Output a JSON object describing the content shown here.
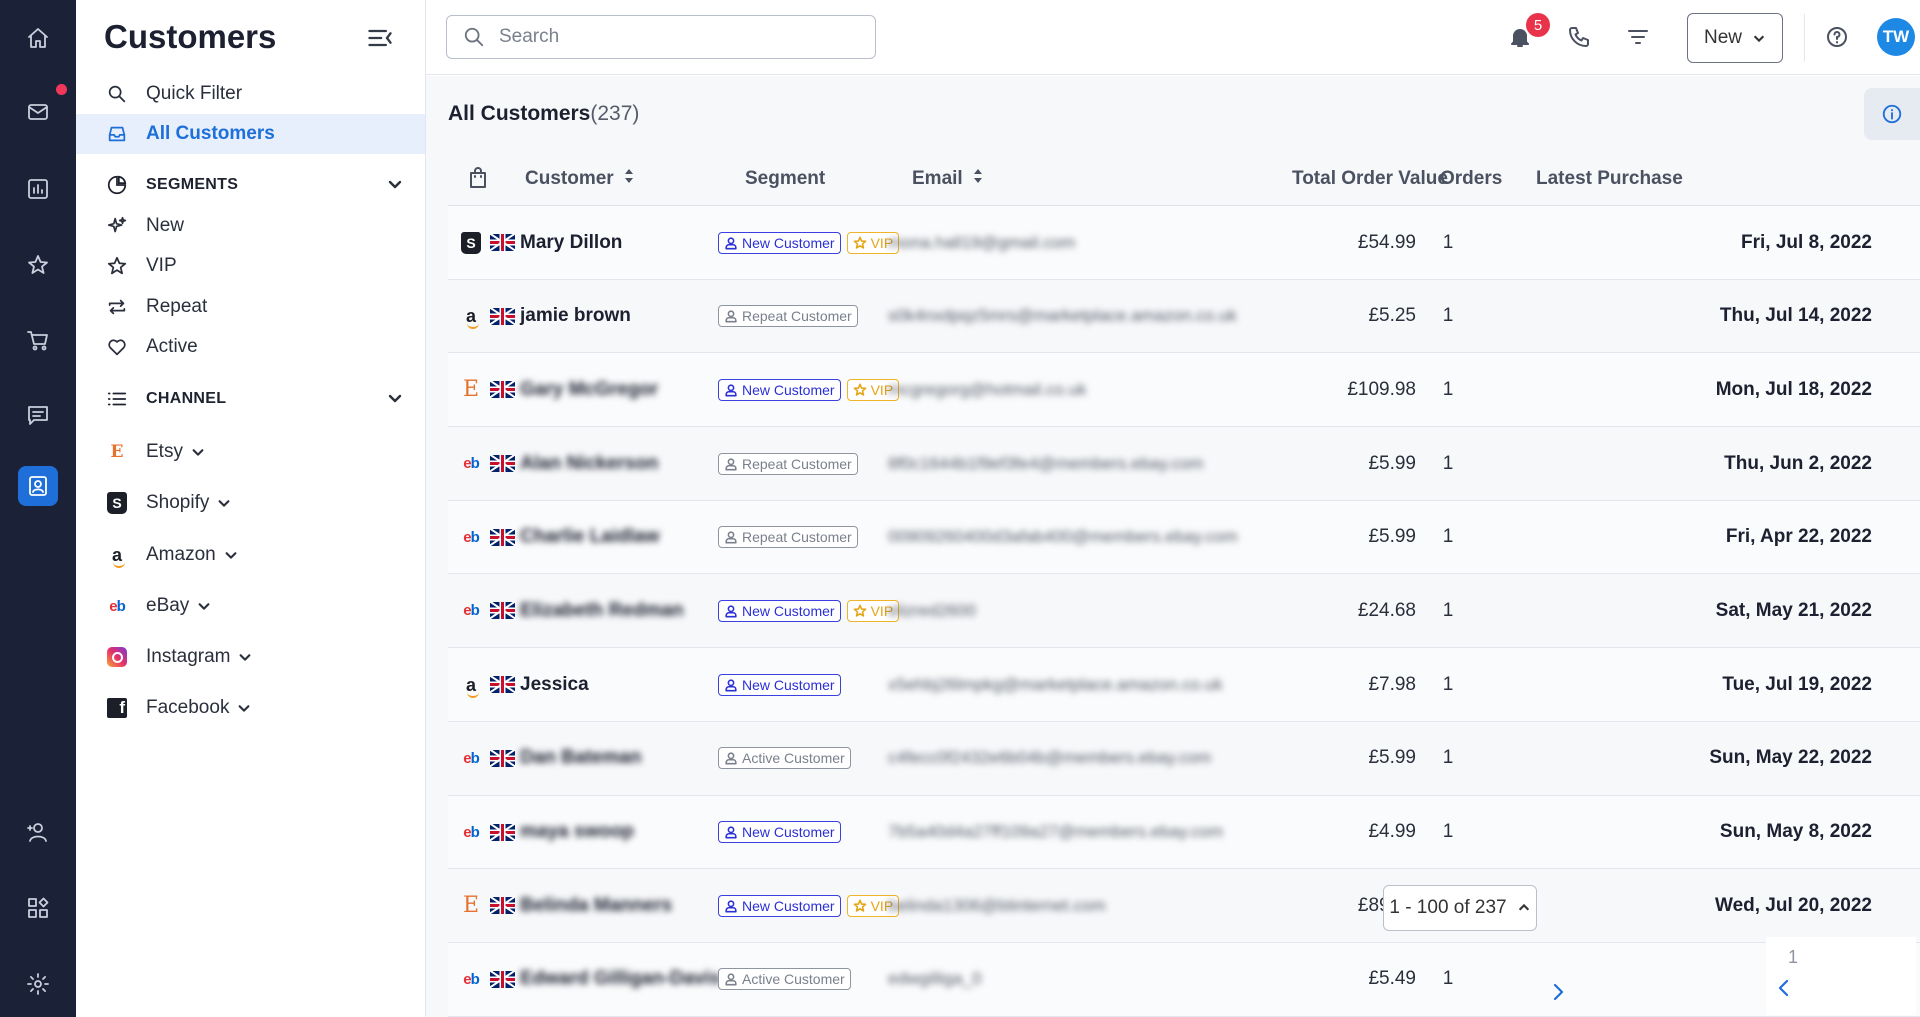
{
  "rail": {
    "items": [
      "home-icon",
      "mail-icon",
      "reports-icon",
      "star-icon",
      "cart-icon",
      "messages-icon",
      "contacts-icon"
    ],
    "bottom": [
      "add-user-icon",
      "apps-icon",
      "settings-icon"
    ],
    "notification_dot_color": "#f2385a",
    "active_color": "#1e6fd9"
  },
  "sidebar": {
    "title": "Customers",
    "quick_filter": "Quick Filter",
    "all_customers": "All Customers",
    "segments_heading": "SEGMENTS",
    "segments": [
      "New",
      "VIP",
      "Repeat",
      "Active"
    ],
    "channel_heading": "CHANNEL",
    "channels": [
      "Etsy",
      "Shopify",
      "Amazon",
      "eBay",
      "Instagram",
      "Facebook"
    ]
  },
  "topbar": {
    "search_placeholder": "Search",
    "notifications_count": "5",
    "new_button": "New",
    "avatar_initials": "TW"
  },
  "main": {
    "title": "All Customers",
    "count": "(237)",
    "columns": {
      "customer": "Customer",
      "segment": "Segment",
      "email": "Email",
      "total": "Total Order Value",
      "orders": "Orders",
      "latest": "Latest Purchase"
    },
    "rows": [
      {
        "channel": "shopify",
        "name": "Mary Dillon",
        "blurred": false,
        "segment": "New Customer",
        "vip": true,
        "email": "mona.hall19@gmail.com",
        "total": "£54.99",
        "orders": "1",
        "latest": "Fri, Jul 8, 2022"
      },
      {
        "channel": "amazon",
        "name": "jamie brown",
        "blurred": false,
        "segment": "Repeat Customer",
        "vip": false,
        "email": "s0k4nxdpqz5mrs@marketplace.amazon.co.uk",
        "total": "£5.25",
        "orders": "1",
        "latest": "Thu, Jul 14, 2022"
      },
      {
        "channel": "etsy",
        "name": "Gary McGregor",
        "blurred": true,
        "segment": "New Customer",
        "vip": true,
        "email": "mcgregorg@hotmail.co.uk",
        "total": "£109.98",
        "orders": "1",
        "latest": "Mon, Jul 18, 2022"
      },
      {
        "channel": "ebay",
        "name": "Alan Nickerson",
        "blurred": true,
        "segment": "Repeat Customer",
        "vip": false,
        "email": "8f0c1644b1f9ef3fe4@members.ebay.com",
        "total": "£5.99",
        "orders": "1",
        "latest": "Thu, Jun 2, 2022"
      },
      {
        "channel": "ebay",
        "name": "Charlie Laidlaw",
        "blurred": true,
        "segment": "Repeat Customer",
        "vip": false,
        "email": "00909260400d3afab400@members.ebay.com",
        "total": "£5.99",
        "orders": "1",
        "latest": "Fri, Apr 22, 2022"
      },
      {
        "channel": "ebay",
        "name": "Elizabeth Redman",
        "blurred": true,
        "segment": "New Customer",
        "vip": true,
        "email": "elizred2600",
        "total": "£24.68",
        "orders": "1",
        "latest": "Sat, May 21, 2022"
      },
      {
        "channel": "amazon",
        "name": "Jessica",
        "blurred": false,
        "segment": "New Customer",
        "vip": false,
        "email": "x5ehbj26lmpkg@marketplace.amazon.co.uk",
        "total": "£7.98",
        "orders": "1",
        "latest": "Tue, Jul 19, 2022"
      },
      {
        "channel": "ebay",
        "name": "Dan Bateman",
        "blurred": true,
        "segment": "Active Customer",
        "vip": false,
        "email": "c4fecc0f2432e6b04b@members.ebay.com",
        "total": "£5.99",
        "orders": "1",
        "latest": "Sun, May 22, 2022"
      },
      {
        "channel": "ebay",
        "name": "maya swoop",
        "blurred": true,
        "segment": "New Customer",
        "vip": false,
        "email": "7b5a40d4a27ff109a27@members.ebay.com",
        "total": "£4.99",
        "orders": "1",
        "latest": "Sun, May 8, 2022"
      },
      {
        "channel": "etsy",
        "name": "Belinda Manners",
        "blurred": true,
        "segment": "New Customer",
        "vip": true,
        "email": "belinda1306@btinternet.com",
        "total": "£89.99",
        "orders": "1",
        "latest": "Wed, Jul 20, 2022"
      },
      {
        "channel": "ebay",
        "name": "Edward Gilligan-Davis",
        "blurred": true,
        "segment": "Active Customer",
        "vip": false,
        "email": "edwgilliga_0",
        "total": "£5.49",
        "orders": "1",
        "latest": ""
      }
    ],
    "vip_label": "VIP"
  },
  "pagination": {
    "range": "1 - 100 of 237",
    "page_hint": "1"
  }
}
